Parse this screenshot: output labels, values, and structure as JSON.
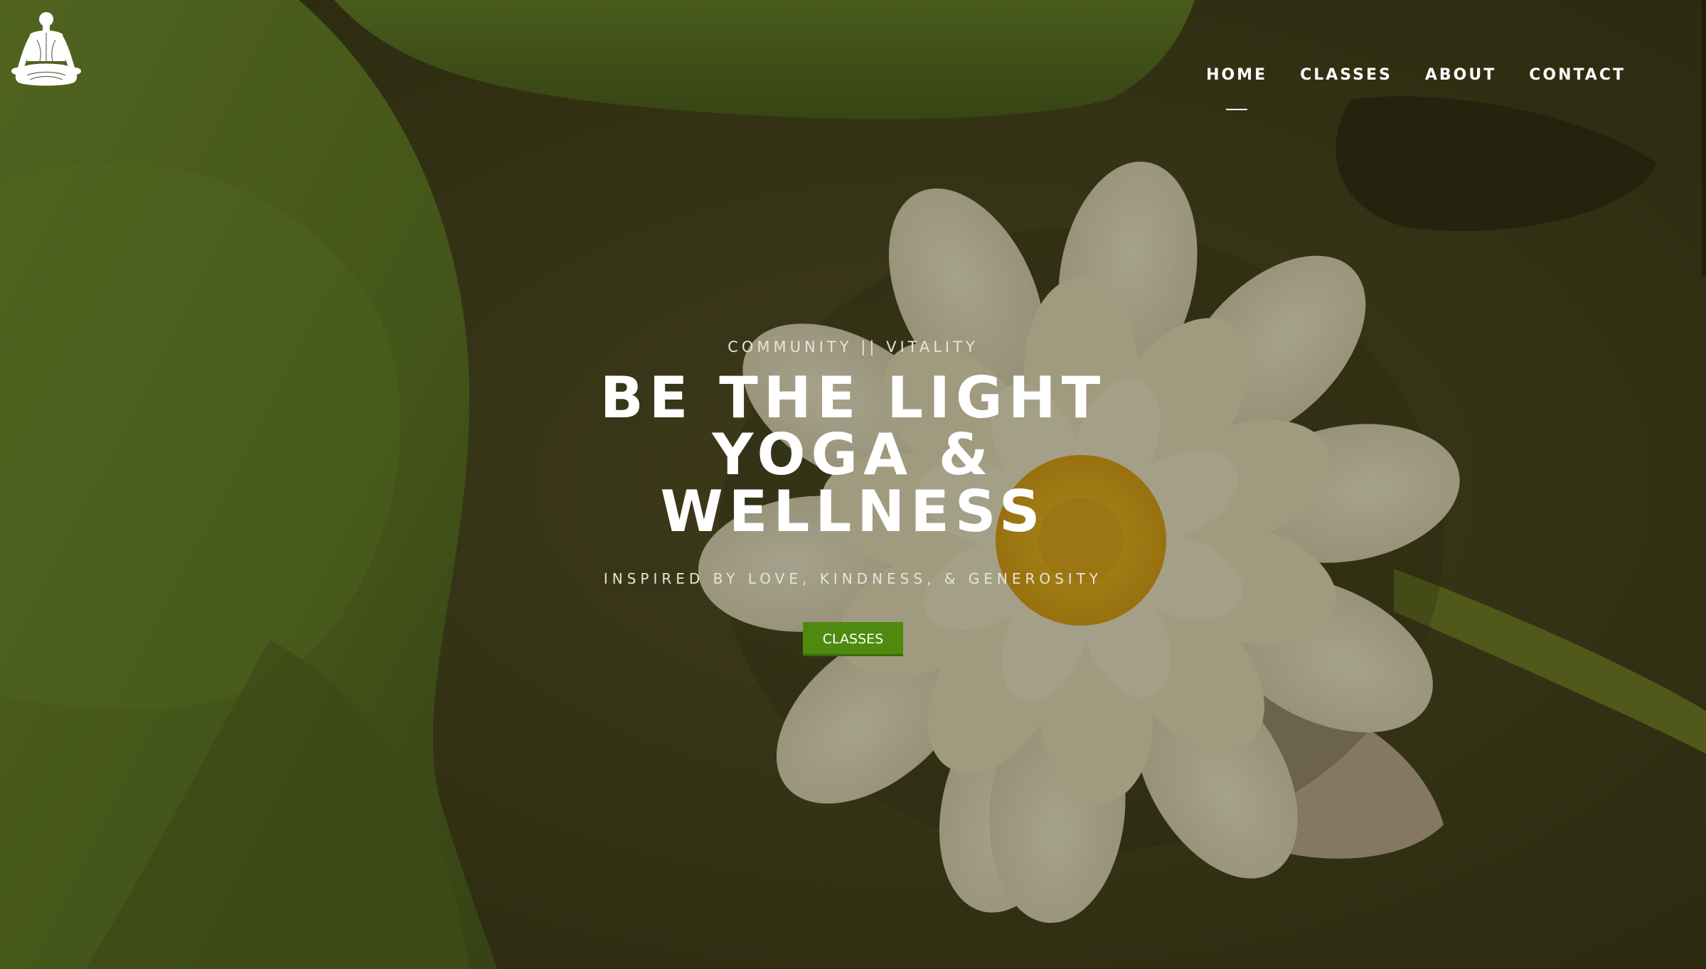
{
  "nav": {
    "items": [
      {
        "label": "HOME",
        "active": true
      },
      {
        "label": "CLASSES",
        "active": false
      },
      {
        "label": "ABOUT",
        "active": false
      },
      {
        "label": "CONTACT",
        "active": false
      }
    ]
  },
  "hero": {
    "kicker": "COMMUNITY || VITALITY",
    "headline_lines": [
      "BE THE LIGHT",
      "YOGA &",
      "WELLNESS"
    ],
    "tagline": "INSPIRED BY LOVE, KINDNESS, & GENEROSITY",
    "cta_label": "CLASSES"
  },
  "icons": {
    "logo": "meditation-figure-icon"
  },
  "colors": {
    "cta_background": "#4e8a0f",
    "text": "#ffffff",
    "overlay": "#26240c"
  }
}
